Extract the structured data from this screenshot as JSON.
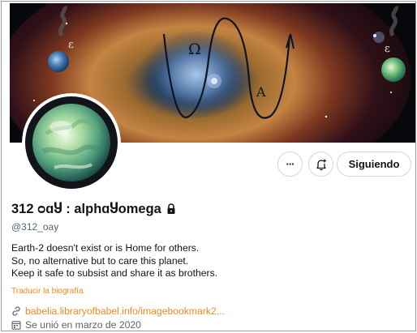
{
  "banner": {
    "greek_left": "ε",
    "greek_right": "ε",
    "omega": "Ω",
    "alpha": "A"
  },
  "actions": {
    "more_label": "···",
    "follow_label": "Siguiendo"
  },
  "profile": {
    "display_name": "312 ᴑɑႸ : alphɑႸomega",
    "handle": "@312_oay",
    "bio_lines": [
      "Earth-2 doesn't exist or is Home for others.",
      "So, no alternative but to care this planet.",
      "Keep it safe to subsist and share it as brothers."
    ],
    "translate_label": "Traducir la biografía",
    "website": "babelia.libraryofbabel.info/imagebookmark2...",
    "joined": "Se unió en marzo de 2020"
  },
  "icons": {
    "protected": "lock-icon",
    "notifications": "bell-plus-icon",
    "website": "link-icon",
    "joined": "calendar-icon"
  },
  "colors": {
    "link_orange": "#f28a1e",
    "secondary_text": "#536471",
    "button_border": "#cfd9de"
  }
}
